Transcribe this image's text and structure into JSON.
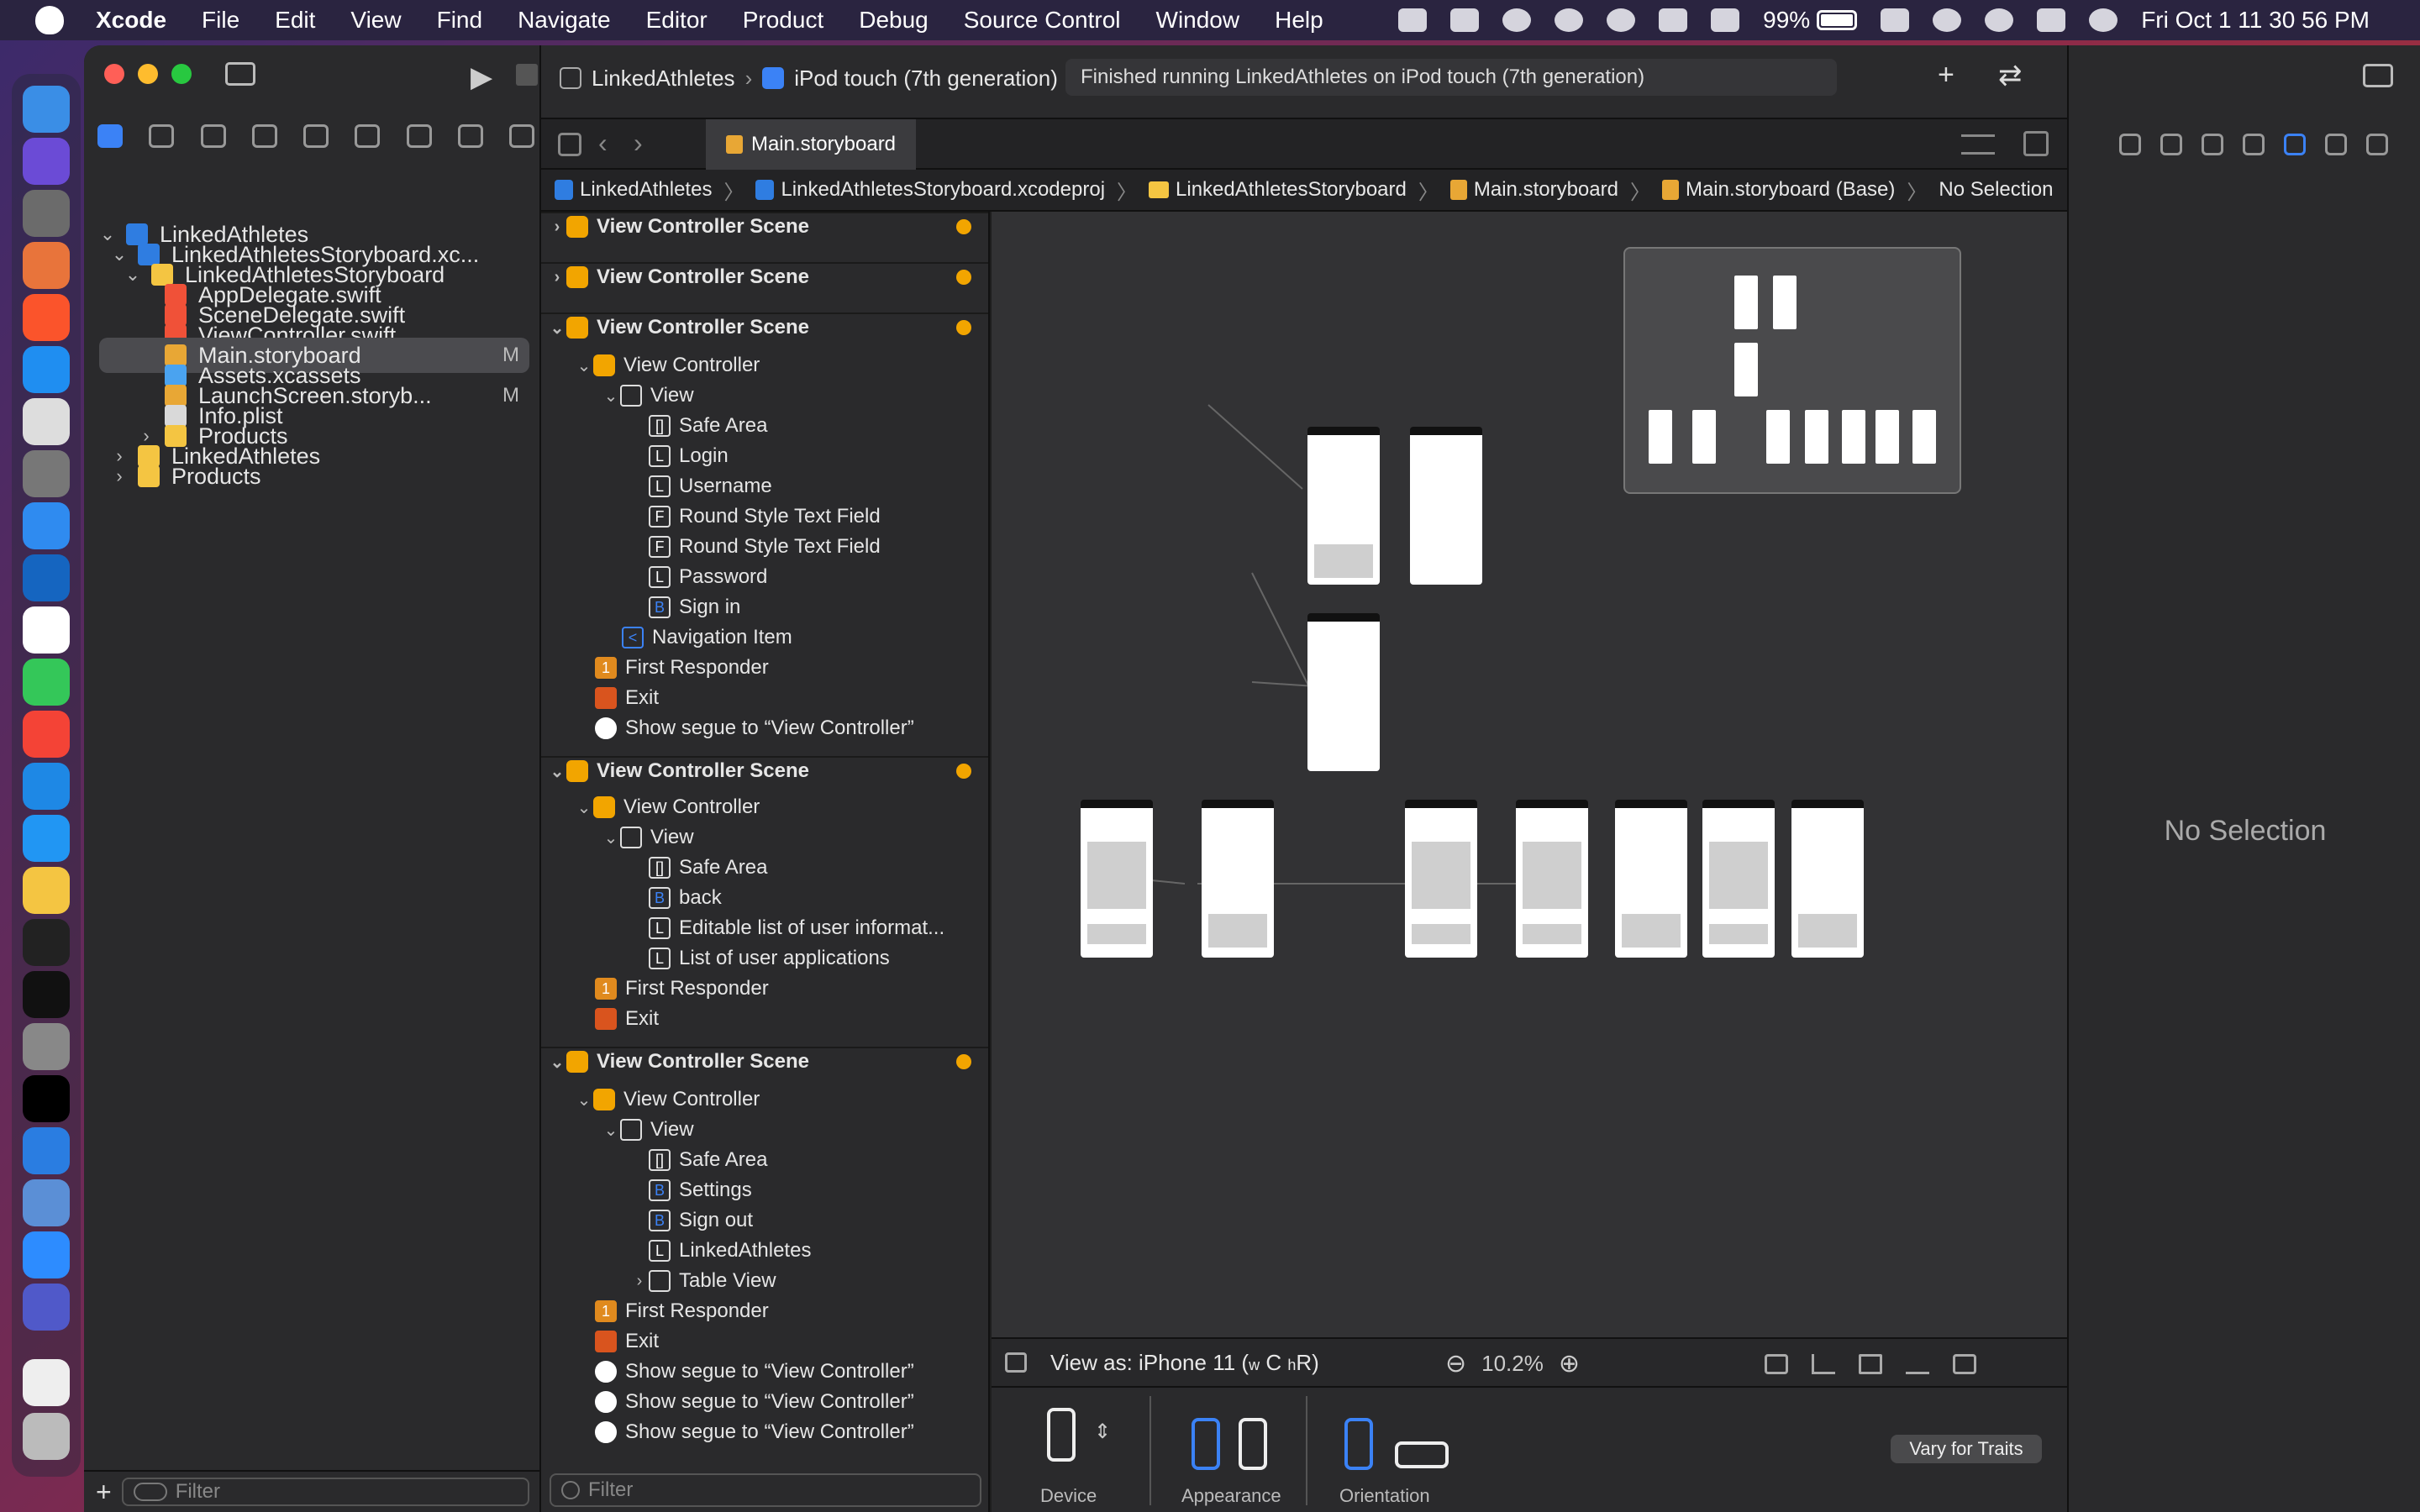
{
  "menubar": {
    "app": "Xcode",
    "items": [
      "File",
      "Edit",
      "View",
      "Find",
      "Navigate",
      "Editor",
      "Product",
      "Debug",
      "Source Control",
      "Window",
      "Help"
    ],
    "battery": "99%",
    "clock": "Fri Oct 1  11 30 56 PM"
  },
  "toolbar": {
    "scheme_project": "LinkedAthletes",
    "scheme_device": "iPod touch (7th generation)",
    "status": "Finished running LinkedAthletes on iPod touch (7th generation)"
  },
  "navigator": {
    "items": [
      {
        "label": "LinkedAthletes",
        "badge": ""
      },
      {
        "label": "LinkedAthletesStoryboard.xc...",
        "badge": ""
      },
      {
        "label": "LinkedAthletesStoryboard",
        "badge": ""
      },
      {
        "label": "AppDelegate.swift",
        "badge": ""
      },
      {
        "label": "SceneDelegate.swift",
        "badge": ""
      },
      {
        "label": "ViewController.swift",
        "badge": ""
      },
      {
        "label": "Main.storyboard",
        "badge": "M"
      },
      {
        "label": "Assets.xcassets",
        "badge": ""
      },
      {
        "label": "LaunchScreen.storyb...",
        "badge": "M"
      },
      {
        "label": "Info.plist",
        "badge": ""
      },
      {
        "label": "Products",
        "badge": ""
      },
      {
        "label": "LinkedAthletes",
        "badge": ""
      },
      {
        "label": "Products",
        "badge": ""
      }
    ],
    "filter_placeholder": "Filter"
  },
  "editor": {
    "tab": "Main.storyboard",
    "jumpbar": [
      "LinkedAthletes",
      "LinkedAthletesStoryboard.xcodeproj",
      "LinkedAthletesStoryboard",
      "Main.storyboard",
      "Main.storyboard (Base)",
      "No Selection"
    ]
  },
  "outline": {
    "rows": [
      {
        "label": "View Controller Scene",
        "icon": "V"
      },
      {
        "label": "View Controller Scene",
        "icon": "V"
      },
      {
        "label": "View Controller Scene",
        "icon": "V"
      },
      {
        "label": "View Controller",
        "icon": ""
      },
      {
        "label": "View",
        "icon": ""
      },
      {
        "label": "Safe Area",
        "icon": "[]"
      },
      {
        "label": "Login",
        "icon": "L"
      },
      {
        "label": "Username",
        "icon": "L"
      },
      {
        "label": "Round Style Text Field",
        "icon": "F"
      },
      {
        "label": "Round Style Text Field",
        "icon": "F"
      },
      {
        "label": "Password",
        "icon": "L"
      },
      {
        "label": "Sign in",
        "icon": "B"
      },
      {
        "label": "Navigation Item",
        "icon": "<"
      },
      {
        "label": "First Responder",
        "icon": "1"
      },
      {
        "label": "Exit",
        "icon": ""
      },
      {
        "label": "Show segue to “View Controller”",
        "icon": ""
      },
      {
        "label": "View Controller Scene",
        "icon": "V"
      },
      {
        "label": "View Controller",
        "icon": ""
      },
      {
        "label": "View",
        "icon": ""
      },
      {
        "label": "Safe Area",
        "icon": "[]"
      },
      {
        "label": "back",
        "icon": "B"
      },
      {
        "label": "Editable list of user informat...",
        "icon": "L"
      },
      {
        "label": "List of user applications",
        "icon": "L"
      },
      {
        "label": "First Responder",
        "icon": "1"
      },
      {
        "label": "Exit",
        "icon": ""
      },
      {
        "label": "View Controller Scene",
        "icon": "V"
      },
      {
        "label": "View Controller",
        "icon": ""
      },
      {
        "label": "View",
        "icon": ""
      },
      {
        "label": "Safe Area",
        "icon": "[]"
      },
      {
        "label": "Settings",
        "icon": "B"
      },
      {
        "label": "Sign out",
        "icon": "B"
      },
      {
        "label": "LinkedAthletes",
        "icon": "L"
      },
      {
        "label": "Table View",
        "icon": ""
      },
      {
        "label": "First Responder",
        "icon": "1"
      },
      {
        "label": "Exit",
        "icon": ""
      },
      {
        "label": "Show segue to “View Controller”",
        "icon": ""
      },
      {
        "label": "Show segue to “View Controller”",
        "icon": ""
      },
      {
        "label": "Show segue to “View Controller”",
        "icon": ""
      }
    ],
    "filter_placeholder": "Filter"
  },
  "canvas": {
    "view_as_prefix": "View as: iPhone 11 (",
    "view_as_w": "w",
    "view_as_c": "C",
    "view_as_h": "h",
    "view_as_r": "R",
    "view_as_suffix": ")",
    "zoom": "10.2%"
  },
  "traits": {
    "device": "Device",
    "appearance": "Appearance",
    "orientation": "Orientation",
    "vary": "Vary for Traits"
  },
  "inspector": {
    "empty": "No Selection"
  },
  "colors": {
    "accent": "#3b82f6",
    "scene_dot": "#f2a500",
    "canvas_bg": "#323234"
  }
}
